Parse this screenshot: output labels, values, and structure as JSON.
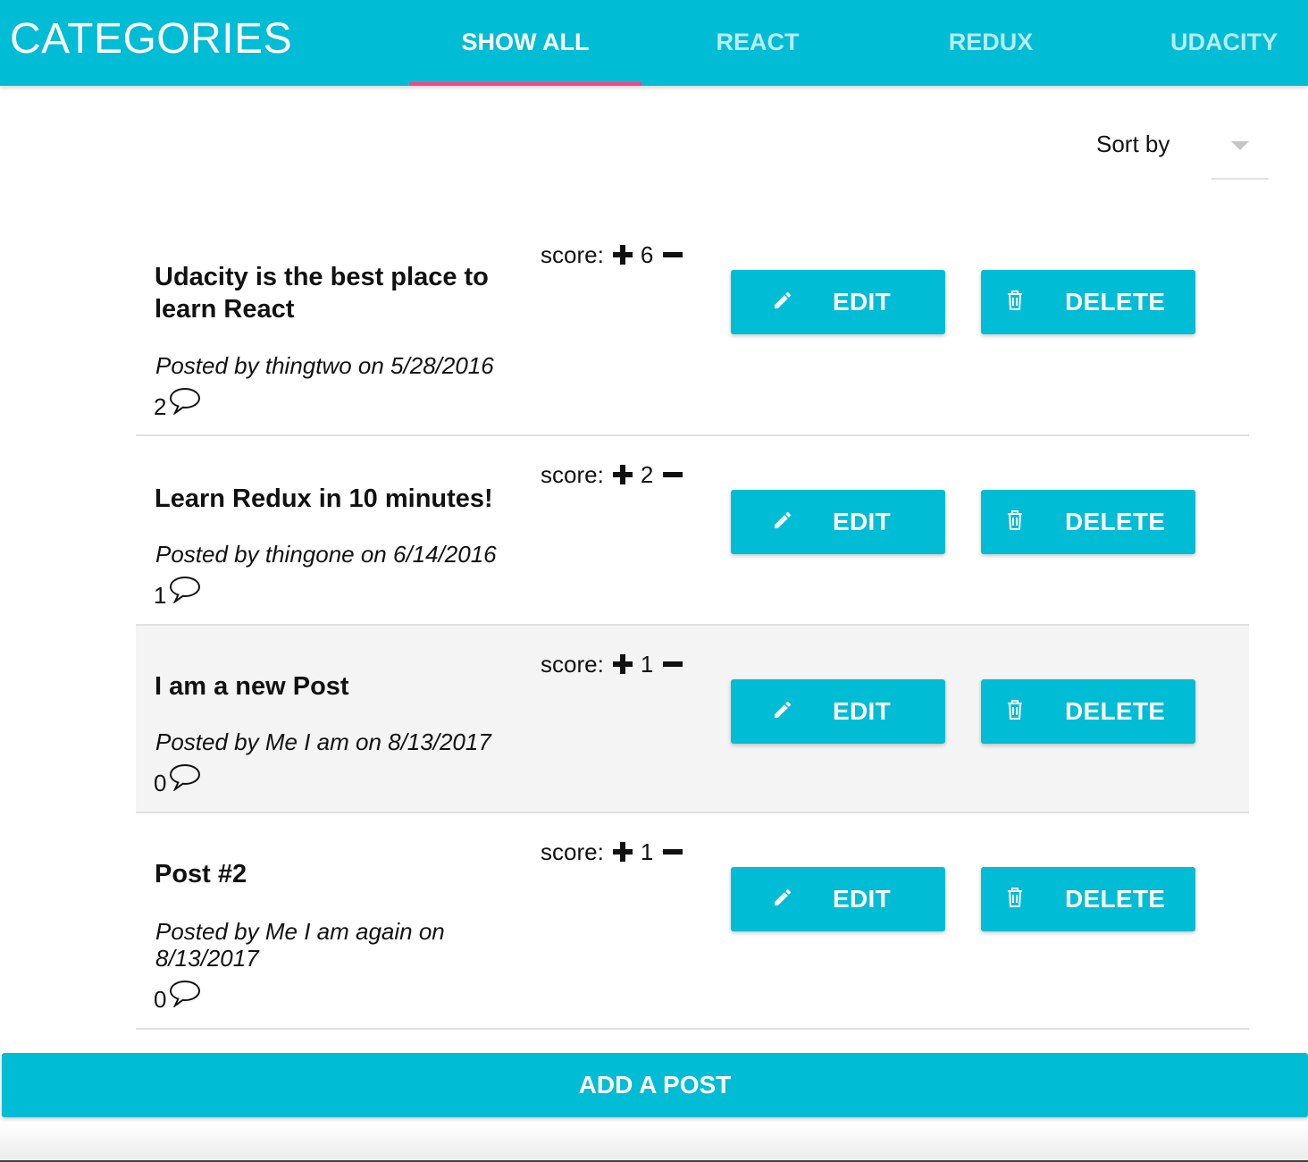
{
  "header": {
    "title": "CATEGORIES",
    "tabs": [
      {
        "label": "SHOW ALL",
        "active": true
      },
      {
        "label": "REACT",
        "active": false
      },
      {
        "label": "REDUX",
        "active": false
      },
      {
        "label": "UDACITY",
        "active": false
      }
    ]
  },
  "sort": {
    "label": "Sort by",
    "selected": ""
  },
  "actions": {
    "edit_label": "EDIT",
    "delete_label": "DELETE"
  },
  "posts": [
    {
      "title": "Udacity is the best place to learn React",
      "meta": "Posted by thingtwo on 5/28/2016",
      "score_label": "score:",
      "score": "6",
      "comments": "2"
    },
    {
      "title": "Learn Redux in 10 minutes!",
      "meta": "Posted by thingone on 6/14/2016",
      "score_label": "score:",
      "score": "2",
      "comments": "1"
    },
    {
      "title": "I am a new Post",
      "meta": "Posted by Me I am on 8/13/2017",
      "score_label": "score:",
      "score": "1",
      "comments": "0"
    },
    {
      "title": "Post #2",
      "meta": "Posted by Me I am again on 8/13/2017",
      "score_label": "score:",
      "score": "1",
      "comments": "0"
    }
  ],
  "add_post_label": "ADD A POST",
  "colors": {
    "primary": "#00bcd4",
    "accent": "#ff4081",
    "highlight_row": "#f4f4f4"
  }
}
